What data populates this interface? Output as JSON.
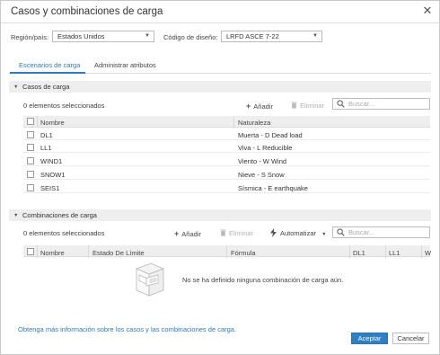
{
  "dialog": {
    "title": "Casos y combinaciones de carga",
    "close_glyph": "✕"
  },
  "filters": {
    "region_label": "Región/país:",
    "region_value": "Estados Unidos",
    "code_label": "Código de diseño:",
    "code_value": "LRFD ASCE 7-22"
  },
  "tabs": [
    {
      "label": "Escenarios de carga",
      "active": true
    },
    {
      "label": "Administrar atributos",
      "active": false
    }
  ],
  "load_cases": {
    "section_title": "Casos de carga",
    "selected_count": "0 elementos seleccionados",
    "add_label": "Añadir",
    "delete_label": "Eliminar",
    "search_placeholder": "Buscar...",
    "columns": [
      "Nombre",
      "Naturaleza"
    ],
    "rows": [
      {
        "name": "DL1",
        "nature": "Muerta - D Dead load"
      },
      {
        "name": "LL1",
        "nature": "Viva - L Reducible"
      },
      {
        "name": "WIND1",
        "nature": "Viento - W Wind"
      },
      {
        "name": "SNOW1",
        "nature": "Nieve - S Snow"
      },
      {
        "name": "SEIS1",
        "nature": "Sísmica - E earthquake"
      }
    ]
  },
  "load_combinations": {
    "section_title": "Combinaciones de carga",
    "selected_count": "0 elementos seleccionados",
    "add_label": "Añadir",
    "delete_label": "Eliminar",
    "automate_label": "Automatizar",
    "search_placeholder": "Buscar...",
    "columns": [
      "Nombre",
      "Estado De Límite",
      "Fórmula",
      "DL1",
      "LL1",
      "W"
    ],
    "empty_message": "No se ha definido ninguna combinación de carga aún."
  },
  "footer": {
    "info_link": "Obtenga más información sobre los casos y las combinaciones de carga.",
    "accept_label": "Aceptar",
    "cancel_label": "Cancelar"
  },
  "colors": {
    "accent": "#2a7bbf",
    "primary_button": "#2e7fc4",
    "section_bg": "#eeeeee"
  },
  "icons": [
    "close-icon",
    "chevron-down-icon",
    "collapse-triangle-icon",
    "plus-icon",
    "trash-icon",
    "search-icon",
    "automate-icon",
    "empty-state-cabinet-icon"
  ]
}
